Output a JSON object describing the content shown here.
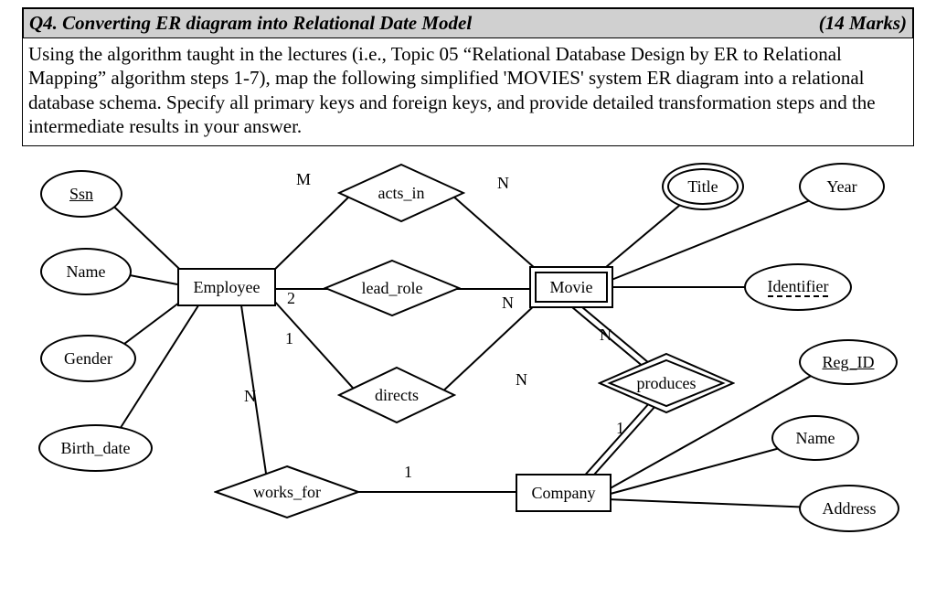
{
  "header": {
    "q_label": "Q4. Converting ER diagram into Relational Date Model",
    "marks": "(14 Marks)"
  },
  "description": "Using the algorithm taught in the lectures (i.e., Topic 05 “Relational Database Design by ER to Relational Mapping” algorithm steps 1-7), map the following simplified 'MOVIES' system ER diagram into a relational database schema. Specify all primary keys and foreign keys, and provide detailed transformation steps and the intermediate results in your answer.",
  "entities": {
    "employee": "Employee",
    "movie": "Movie",
    "company": "Company"
  },
  "relationships": {
    "acts_in": "acts_in",
    "lead_role": "lead_role",
    "directs": "directs",
    "works_for": "works_for",
    "produces": "produces"
  },
  "attributes": {
    "ssn": "Ssn",
    "name_emp": "Name",
    "gender": "Gender",
    "birth_date": "Birth_date",
    "title": "Title",
    "year": "Year",
    "identifier": "Identifier",
    "reg_id": "Reg_ID",
    "name_co": "Name",
    "address": "Address"
  },
  "cardinalities": {
    "acts_in_emp": "M",
    "acts_in_mov": "N",
    "lead_role_emp": "2",
    "lead_role_mov": "N",
    "directs_emp": "1",
    "directs_mov": "N",
    "works_for_emp": "N",
    "works_for_co": "1",
    "produces_mov": "N",
    "produces_co": "1"
  }
}
